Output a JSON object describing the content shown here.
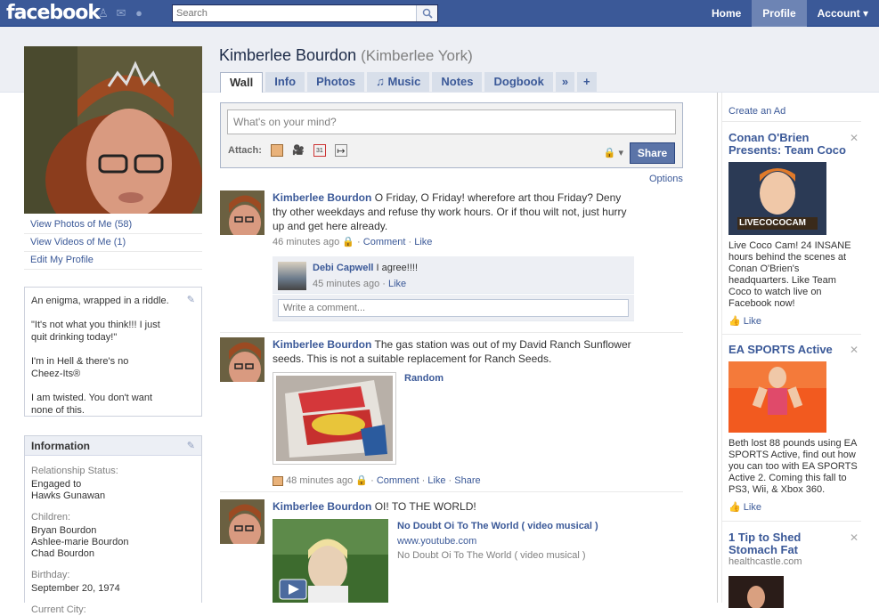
{
  "topbar": {
    "logo": "facebook",
    "search_placeholder": "Search",
    "nav": [
      "Home",
      "Profile",
      "Account ▾"
    ]
  },
  "profile": {
    "name": "Kimberlee Bourdon",
    "alt_name": "(Kimberlee York)",
    "left_links": [
      "View Photos of Me (58)",
      "View Videos of Me (1)",
      "Edit My Profile"
    ],
    "about": [
      "An enigma, wrapped in a riddle.",
      "\"It's not what you think!!! I just quit drinking today!\"",
      "I'm in Hell & there's no Cheez-Its®",
      "I am twisted. You don't want none of this."
    ],
    "info_header": "Information",
    "info": {
      "relationship_label": "Relationship Status:",
      "relationship_value": "Engaged to",
      "relationship_link": "Hawks Gunawan",
      "children_label": "Children:",
      "children": [
        "Bryan Bourdon",
        "Ashlee-marie Bourdon",
        "Chad Bourdon"
      ],
      "birthday_label": "Birthday:",
      "birthday_value": "September 20, 1974",
      "city_label": "Current City:"
    }
  },
  "tabs": [
    "Wall",
    "Info",
    "Photos",
    "♫ Music",
    "Notes",
    "Dogbook",
    "»",
    "+"
  ],
  "composer": {
    "placeholder": "What's on your mind?",
    "attach_label": "Attach:",
    "share_label": "Share",
    "options_label": "Options"
  },
  "stories": [
    {
      "actor": "Kimberlee Bourdon",
      "text": "O Friday, O Friday! wherefore art thou Friday? Deny thy other weekdays and refuse thy work hours. Or if thou wilt not, just hurry up and get here already.",
      "time": "46 minutes ago",
      "actions": [
        "Comment",
        "Like"
      ],
      "comment": {
        "author": "Debi Capwell",
        "text": "I agree!!!!",
        "time": "45 minutes ago",
        "like": "Like"
      },
      "write_comment": "Write a comment..."
    },
    {
      "actor": "Kimberlee Bourdon",
      "text": "The gas station was out of my David Ranch Sunflower seeds. This is not a suitable replacement for Ranch Seeds.",
      "attachment_title": "Random",
      "time": "48 minutes ago",
      "actions": [
        "Comment",
        "Like",
        "Share"
      ]
    },
    {
      "actor": "Kimberlee Bourdon",
      "text": "OI! TO THE WORLD!",
      "link_title": "No Doubt Oi To The World ( video musical )",
      "link_domain": "www.youtube.com",
      "link_desc": "No Doubt Oi To The World ( video musical )"
    }
  ],
  "ads": {
    "create_ad": "Create an Ad",
    "items": [
      {
        "title": "Conan O'Brien Presents: Team Coco",
        "image_caption": "LIVECOCOCAM",
        "text": "Live Coco Cam! 24 INSANE hours behind the scenes at Conan O'Brien's headquarters. Like Team Coco to watch live on Facebook now!",
        "like": "Like"
      },
      {
        "title": "EA SPORTS Active",
        "text": "Beth lost 88 pounds using EA SPORTS Active, find out how you can too with EA SPORTS Active 2. Coming this fall to PS3, Wii, & Xbox 360.",
        "like": "Like"
      },
      {
        "title": "1 Tip to Shed Stomach Fat",
        "source": "healthcastle.com"
      }
    ]
  },
  "colors": {
    "brand_blue": "#3b5998",
    "nav_active": "#6d84b4",
    "panel_gray": "#edeff4"
  }
}
